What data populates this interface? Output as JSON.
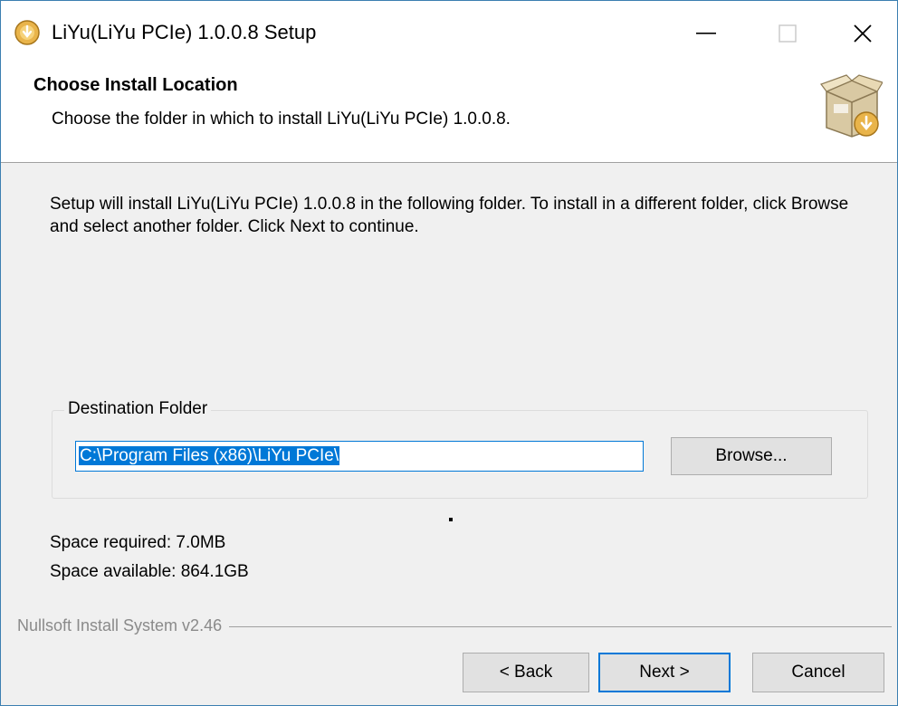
{
  "window": {
    "title": "LiYu(LiYu PCIe) 1.0.0.8 Setup",
    "icon": "installer-disc-icon"
  },
  "header": {
    "title": "Choose Install Location",
    "subtitle": "Choose the folder in which to install LiYu(LiYu PCIe) 1.0.0.8.",
    "icon": "install-box-icon"
  },
  "body": {
    "intro": "Setup will install LiYu(LiYu PCIe) 1.0.0.8 in the following folder. To install in a different folder, click Browse and select another folder. Click Next to continue.",
    "destination": {
      "legend": "Destination Folder",
      "path": "C:\\Program Files (x86)\\LiYu PCIe\\",
      "browse_label": "Browse..."
    },
    "space_required": "Space required: 7.0MB",
    "space_available": "Space available: 864.1GB"
  },
  "footer": {
    "branding": "Nullsoft Install System v2.46",
    "back_label": "< Back",
    "next_label": "Next >",
    "cancel_label": "Cancel"
  },
  "colors": {
    "accent": "#0078d7",
    "button_face": "#e1e1e1",
    "dialog_bg": "#f0f0f0"
  }
}
